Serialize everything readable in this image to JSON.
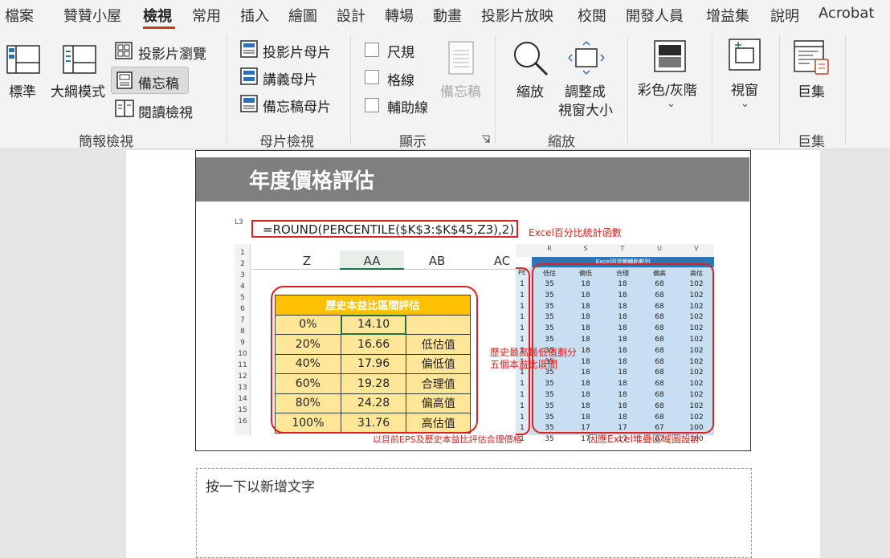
{
  "tabs": [
    "檔案",
    "贊贊小屋",
    "檢視",
    "常用",
    "插入",
    "繪圖",
    "設計",
    "轉場",
    "動畫",
    "投影片放映",
    "校閱",
    "開發人員",
    "增益集",
    "說明",
    "Acrobat"
  ],
  "active_tab": "檢視",
  "ribbon": {
    "presentation_views": {
      "group_label": "簡報檢視",
      "normal": "標準",
      "outline": "大綱模式",
      "slide_sorter": "投影片瀏覽",
      "notes_page": "備忘稿",
      "reading_view": "閱讀檢視"
    },
    "master_views": {
      "group_label": "母片檢視",
      "slide_master": "投影片母片",
      "handout_master": "講義母片",
      "notes_master": "備忘稿母片"
    },
    "show": {
      "group_label": "顯示",
      "ruler": "尺規",
      "gridlines": "格線",
      "guides": "輔助線",
      "notes": "備忘稿"
    },
    "zoom": {
      "group_label": "縮放",
      "zoom": "縮放",
      "fit_line1": "調整成",
      "fit_line2": "視窗大小"
    },
    "color": {
      "label": "彩色/灰階"
    },
    "window": {
      "label": "視窗"
    },
    "macros": {
      "label": "巨集",
      "group_label": "巨集"
    }
  },
  "slide": {
    "title": "年度價格評估",
    "name_box": "L3",
    "formula": "=ROUND(PERCENTILE($K$3:$K$45,Z3),2)",
    "anno_func": "Excel百分比統計函數",
    "col_headers": [
      "Z",
      "AA",
      "AB",
      "AC"
    ],
    "row_numbers": [
      "1",
      "2",
      "3",
      "4",
      "5",
      "6",
      "7",
      "8",
      "9",
      "10",
      "11",
      "12",
      "13",
      "14",
      "15",
      "16"
    ],
    "orange_table": {
      "title": "歷史本益比區間評估",
      "rows": [
        {
          "pct": "0%",
          "val": "14.10",
          "label": ""
        },
        {
          "pct": "20%",
          "val": "16.66",
          "label": "低估值"
        },
        {
          "pct": "40%",
          "val": "17.96",
          "label": "偏低值"
        },
        {
          "pct": "60%",
          "val": "19.28",
          "label": "合理值"
        },
        {
          "pct": "80%",
          "val": "24.28",
          "label": "偏高值"
        },
        {
          "pct": "100%",
          "val": "31.76",
          "label": "高估值"
        }
      ]
    },
    "blue_table": {
      "col_letters": [
        "R",
        "S",
        "T",
        "U",
        "V"
      ],
      "title": "Excel河流圖輔助數列",
      "headers": [
        "低估",
        "偏低",
        "合理",
        "偏高",
        "高估"
      ],
      "left_stub_header": "PE",
      "rows": [
        [
          "35",
          "18",
          "18",
          "68",
          "102"
        ],
        [
          "35",
          "18",
          "18",
          "68",
          "102"
        ],
        [
          "35",
          "18",
          "18",
          "68",
          "102"
        ],
        [
          "35",
          "18",
          "18",
          "68",
          "102"
        ],
        [
          "35",
          "18",
          "18",
          "68",
          "102"
        ],
        [
          "35",
          "18",
          "18",
          "68",
          "102"
        ],
        [
          "35",
          "18",
          "18",
          "68",
          "102"
        ],
        [
          "35",
          "18",
          "18",
          "68",
          "102"
        ],
        [
          "35",
          "18",
          "18",
          "68",
          "102"
        ],
        [
          "35",
          "18",
          "18",
          "68",
          "102"
        ],
        [
          "35",
          "18",
          "18",
          "68",
          "102"
        ],
        [
          "35",
          "18",
          "18",
          "68",
          "102"
        ],
        [
          "35",
          "18",
          "18",
          "68",
          "102"
        ],
        [
          "35",
          "17",
          "17",
          "67",
          "100"
        ],
        [
          "35",
          "17",
          "17",
          "67",
          "100"
        ]
      ]
    },
    "anno_divide_1": "歷史最高最低值劃分",
    "anno_divide_2": "五個本益比區間",
    "anno_eps": "以目前EPS及歷史本益比評估合理價格",
    "anno_area": "因應Excel堆疊區域圖設計"
  },
  "notes_placeholder": "按一下以新增文字"
}
